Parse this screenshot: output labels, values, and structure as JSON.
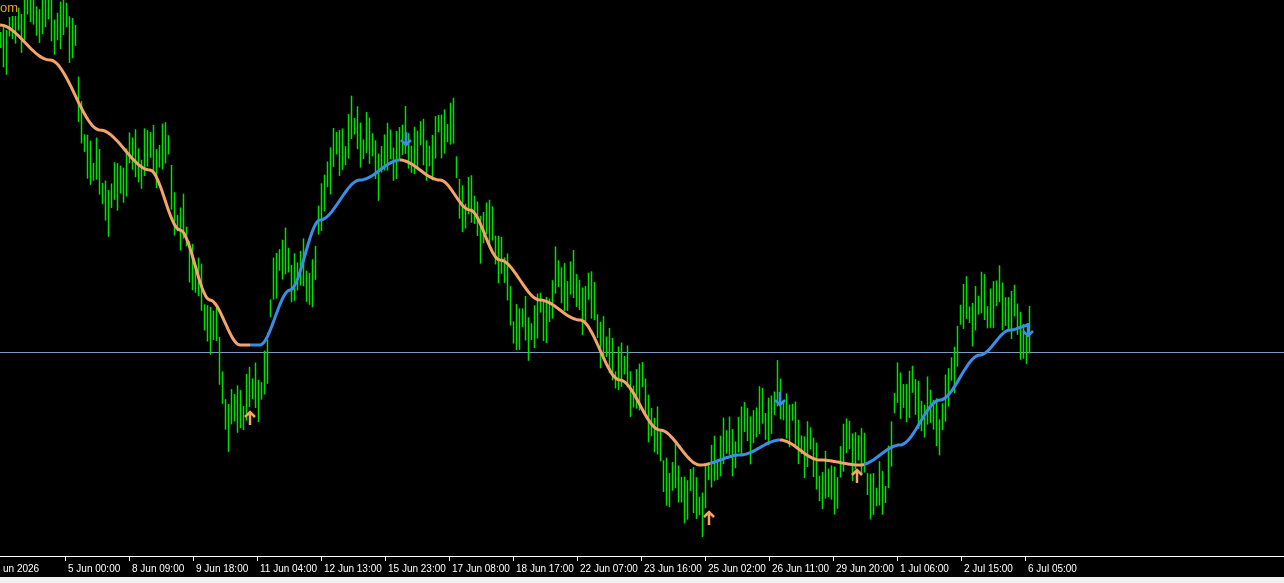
{
  "chart": {
    "corner_label": "om"
  },
  "time_axis": [
    "un 2026",
    "5 Jun 00:00",
    "8 Jun 09:00",
    "9 Jun 18:00",
    "11 Jun 04:00",
    "12 Jun 13:00",
    "15 Jun 23:00",
    "17 Jun 08:00",
    "18 Jun 17:00",
    "22 Jun 07:00",
    "23 Jun 16:00",
    "25 Jun 02:00",
    "26 Jun 11:00",
    "29 Jun 20:00",
    "1 Jul 06:00",
    "2 Jul 15:00",
    "6 Jul 05:00"
  ]
}
